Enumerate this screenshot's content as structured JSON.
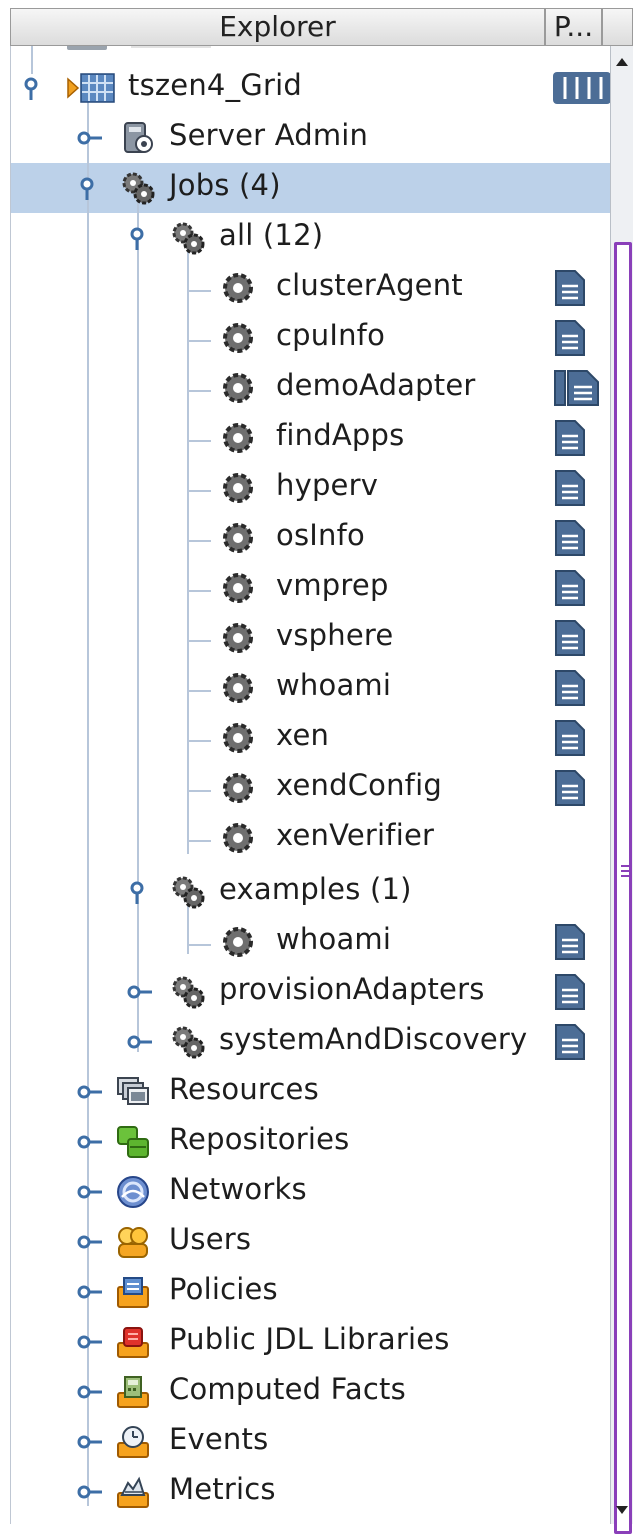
{
  "headers": {
    "explorer": "Explorer",
    "second": "P..."
  },
  "rows": [
    {
      "label": "tszen4_Grid",
      "icon": "grid-icon"
    },
    {
      "label": "Server Admin",
      "icon": "server-admin-icon"
    },
    {
      "label": "Jobs (4)",
      "icon": "job-group-icon"
    },
    {
      "label": "all (12)",
      "icon": "job-group-icon"
    },
    {
      "label": "clusterAgent",
      "icon": "job-gear-icon"
    },
    {
      "label": "cpuInfo",
      "icon": "job-gear-icon"
    },
    {
      "label": "demoAdapter",
      "icon": "job-gear-icon"
    },
    {
      "label": "findApps",
      "icon": "job-gear-icon"
    },
    {
      "label": "hyperv",
      "icon": "job-gear-icon"
    },
    {
      "label": "osInfo",
      "icon": "job-gear-icon"
    },
    {
      "label": "vmprep",
      "icon": "job-gear-icon"
    },
    {
      "label": "vsphere",
      "icon": "job-gear-icon"
    },
    {
      "label": "whoami",
      "icon": "job-gear-icon"
    },
    {
      "label": "xen",
      "icon": "job-gear-icon"
    },
    {
      "label": "xendConfig",
      "icon": "job-gear-icon"
    },
    {
      "label": "xenVerifier",
      "icon": "job-gear-icon"
    },
    {
      "label": "examples (1)",
      "icon": "job-group-icon"
    },
    {
      "label": "whoami",
      "icon": "job-gear-icon"
    },
    {
      "label": "provisionAdapters",
      "icon": "job-group-icon"
    },
    {
      "label": "systemAndDiscovery",
      "icon": "job-group-icon"
    },
    {
      "label": "Resources",
      "icon": "resources-icon"
    },
    {
      "label": "Repositories",
      "icon": "repositories-icon"
    },
    {
      "label": "Networks",
      "icon": "networks-icon"
    },
    {
      "label": "Users",
      "icon": "users-icon"
    },
    {
      "label": "Policies",
      "icon": "policies-icon"
    },
    {
      "label": "Public JDL Libraries",
      "icon": "jdl-library-icon"
    },
    {
      "label": "Computed Facts",
      "icon": "computed-facts-icon"
    },
    {
      "label": "Events",
      "icon": "events-icon"
    },
    {
      "label": "Metrics",
      "icon": "metrics-icon"
    }
  ],
  "colors": {
    "selection": "#bcd1e9",
    "tree_lines": "#b7c6da",
    "scroll_accent": "#8a3fb9",
    "badge_blue": "#4c6d96"
  }
}
